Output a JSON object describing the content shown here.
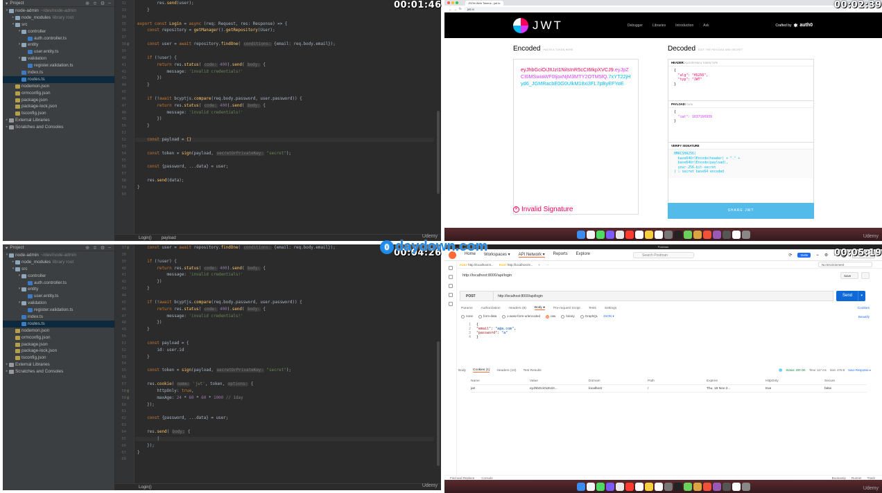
{
  "timestamps": {
    "tl": "00:01:46",
    "tr": "00:02:39",
    "bl": "00:04:26",
    "br": "00:05:19"
  },
  "udemy": "Udemy",
  "ide_top": {
    "project_label": "Project",
    "tree": [
      {
        "label": "node-admin",
        "hint": "~/dev/node-admin",
        "lvl": 0,
        "arrow": "▾",
        "icon": "fo"
      },
      {
        "label": "node_modules",
        "hint": "library root",
        "lvl": 1,
        "arrow": "▸",
        "icon": "fo"
      },
      {
        "label": "src",
        "hint": "",
        "lvl": 1,
        "arrow": "▾",
        "icon": "fo"
      },
      {
        "label": "controller",
        "hint": "",
        "lvl": 2,
        "arrow": "▾",
        "icon": "fo"
      },
      {
        "label": "auth.controller.ts",
        "hint": "",
        "lvl": 3,
        "arrow": "",
        "icon": "fts"
      },
      {
        "label": "entity",
        "hint": "",
        "lvl": 2,
        "arrow": "▾",
        "icon": "fo"
      },
      {
        "label": "user.entity.ts",
        "hint": "",
        "lvl": 3,
        "arrow": "",
        "icon": "fts"
      },
      {
        "label": "validation",
        "hint": "",
        "lvl": 2,
        "arrow": "▾",
        "icon": "fo"
      },
      {
        "label": "register.validation.ts",
        "hint": "",
        "lvl": 3,
        "arrow": "",
        "icon": "fts"
      },
      {
        "label": "index.ts",
        "hint": "",
        "lvl": 2,
        "arrow": "",
        "icon": "fts"
      },
      {
        "label": "routes.ts",
        "hint": "",
        "lvl": 2,
        "arrow": "",
        "icon": "fts",
        "sel": true
      },
      {
        "label": "nodemon.json",
        "hint": "",
        "lvl": 1,
        "arrow": "",
        "icon": "fjs"
      },
      {
        "label": "ormconfig.json",
        "hint": "",
        "lvl": 1,
        "arrow": "",
        "icon": "fjs"
      },
      {
        "label": "package.json",
        "hint": "",
        "lvl": 1,
        "arrow": "",
        "icon": "fjs"
      },
      {
        "label": "package-lock.json",
        "hint": "",
        "lvl": 1,
        "arrow": "",
        "icon": "fjs"
      },
      {
        "label": "tsconfig.json",
        "hint": "",
        "lvl": 1,
        "arrow": "",
        "icon": "fjs"
      },
      {
        "label": "External Libraries",
        "hint": "",
        "lvl": 0,
        "arrow": "▸",
        "icon": "fx"
      },
      {
        "label": "Scratches and Consoles",
        "hint": "",
        "lvl": 0,
        "arrow": "▸",
        "icon": "fx"
      }
    ],
    "code": [
      {
        "n": "32",
        "h": "        res.<span class='f'>send</span>(user);"
      },
      {
        "n": "33",
        "h": "    }"
      },
      {
        "n": "34",
        "h": ""
      },
      {
        "n": "35",
        "h": "<span class='k'>export const</span> <span class='f'>Login</span> = <span class='k'>async</span> (req: Request, res: Response) => {"
      },
      {
        "n": "36",
        "h": "    <span class='k'>const</span> repository = <span class='f'>getManager</span>().<span class='f'>getRepository</span>(User);"
      },
      {
        "n": "37",
        "h": ""
      },
      {
        "n": "38",
        "h": "    <span class='k'>const</span> user = <span class='k'>await</span> repository.<span class='f'>findOne</span>( <span class='h'>conditions:</span> {email: req.body.email});",
        "m": "@"
      },
      {
        "n": "39",
        "h": ""
      },
      {
        "n": "40",
        "h": "    <span class='k'>if</span> (!user) {"
      },
      {
        "n": "41",
        "h": "        <span class='k'>return</span> res.<span class='f'>status</span>( <span class='h'>code:</span> <span class='p'>400</span>).<span class='f'>send</span>( <span class='h'>body:</span> {"
      },
      {
        "n": "42",
        "h": "            message: <span class='s'>'invalid credentials!'</span>"
      },
      {
        "n": "43",
        "h": "        })"
      },
      {
        "n": "44",
        "h": "    }"
      },
      {
        "n": "45",
        "h": ""
      },
      {
        "n": "46",
        "h": "    <span class='k'>if</span> (!<span class='k'>await</span> bcyptjs.<span class='f'>compare</span>(req.body.password, user.password)) {"
      },
      {
        "n": "47",
        "h": "        <span class='k'>return</span> res.<span class='f'>status</span>( <span class='h'>code:</span> <span class='p'>400</span>).<span class='f'>send</span>( <span class='h'>body:</span> {"
      },
      {
        "n": "48",
        "h": "            message: <span class='s'>'invalid credentials!'</span>"
      },
      {
        "n": "49",
        "h": "        })"
      },
      {
        "n": "50",
        "h": "    }"
      },
      {
        "n": "51",
        "h": ""
      },
      {
        "n": "52",
        "h": "    <span class='k'>const</span> payload = <span class='f'>{}</span>",
        "hl": true
      },
      {
        "n": "53",
        "h": ""
      },
      {
        "n": "54",
        "h": "    <span class='k'>const</span> token = <span class='f'>sign</span>(payload, <span class='h'>secretOrPrivateKey:</span> <span class='s'>\"secret\"</span>);"
      },
      {
        "n": "55",
        "h": ""
      },
      {
        "n": "56",
        "h": "    <span class='k'>const</span> {password, ...data} = user;"
      },
      {
        "n": "57",
        "h": ""
      },
      {
        "n": "58",
        "h": "    res.<span class='f'>send</span>(data);"
      },
      {
        "n": "59",
        "h": "}"
      },
      {
        "n": "60",
        "h": ""
      }
    ],
    "breadcrumb": [
      "Login()",
      "payload"
    ]
  },
  "ide_bottom": {
    "project_label": "Project",
    "code": [
      {
        "n": "37",
        "h": "    <span class='k'>const</span> user = <span class='k'>await</span> repository.<span class='f'>findOne</span>( <span class='h'>conditions:</span> {email: req.body.email});",
        "m": "@"
      },
      {
        "n": "38",
        "h": ""
      },
      {
        "n": "39",
        "h": "    <span class='k'>if</span> (!user) {"
      },
      {
        "n": "40",
        "h": "        <span class='k'>return</span> res.<span class='f'>status</span>( <span class='h'>code:</span> <span class='p'>400</span>).<span class='f'>send</span>( <span class='h'>body:</span> {"
      },
      {
        "n": "41",
        "h": "            message: <span class='s'>'invalid credentials!'</span>"
      },
      {
        "n": "42",
        "h": "        })"
      },
      {
        "n": "43",
        "h": "    }"
      },
      {
        "n": "44",
        "h": ""
      },
      {
        "n": "45",
        "h": "    <span class='k'>if</span> (!<span class='k'>await</span> bcyptjs.<span class='f'>compare</span>(req.body.password, user.password)) {"
      },
      {
        "n": "46",
        "h": "        <span class='k'>return</span> res.<span class='f'>status</span>( <span class='h'>code:</span> <span class='p'>400</span>).<span class='f'>send</span>( <span class='h'>body:</span> {"
      },
      {
        "n": "47",
        "h": "            message: <span class='s'>'invalid credentials!'</span>"
      },
      {
        "n": "48",
        "h": "        })"
      },
      {
        "n": "49",
        "h": "    }"
      },
      {
        "n": "50",
        "h": ""
      },
      {
        "n": "51",
        "h": "    <span class='k'>const</span> payload = {"
      },
      {
        "n": "52",
        "h": "        id: user.id"
      },
      {
        "n": "53",
        "h": "    }"
      },
      {
        "n": "54",
        "h": ""
      },
      {
        "n": "55",
        "h": "    <span class='k'>const</span> token = <span class='f'>sign</span>(payload, <span class='h'>secretOrPrivateKey:</span> <span class='s'>\"secret\"</span>);"
      },
      {
        "n": "56",
        "h": ""
      },
      {
        "n": "57",
        "h": "    res.<span class='f'>cookie</span>( <span class='h'>name:</span> <span class='s'>'jwt'</span>, token, <span class='h'>options:</span> {"
      },
      {
        "n": "58",
        "h": "        httpOnly: <span class='k'>true</span>,",
        "m": "@"
      },
      {
        "n": "59",
        "h": "        maxAge: <span class='p'>24</span> * <span class='p'>60</span> * <span class='p'>60</span> * <span class='p'>1000</span> <span style='color:#808080'>// 1day</span>",
        "m": "@"
      },
      {
        "n": "60",
        "h": "    });"
      },
      {
        "n": "61",
        "h": ""
      },
      {
        "n": "62",
        "h": "    <span class='k'>const</span> {password, ...data} = user;"
      },
      {
        "n": "63",
        "h": ""
      },
      {
        "n": "64",
        "h": "    res.<span class='f'>send</span>( <span class='h'>body:</span> {"
      },
      {
        "n": "65",
        "h": "        |",
        "hl": true
      },
      {
        "n": "66",
        "h": "    });"
      },
      {
        "n": "67",
        "h": "}"
      },
      {
        "n": "68",
        "h": ""
      }
    ],
    "breadcrumb": [
      "Login()"
    ]
  },
  "browser": {
    "tab": "JSON Web Tokens - jwt.io",
    "url": "jwt.io",
    "logo": "JWT",
    "nav": [
      "Debugger",
      "Libraries",
      "Introduction",
      "Ask"
    ],
    "crafted": "Crafted by",
    "auth0": "auth0",
    "encoded": "Encoded",
    "encoded_sub": "PASTE A TOKEN HERE",
    "decoded": "Decoded",
    "decoded_sub": "EDIT THE PAYLOAD AND SECRET",
    "tok1": "eyJhbGciOiJIUzI1NiIsInR5cCI6IkpXVCJ9.",
    "tok2": "eyJpZCI6MSwiaWF0IjoxNjM3MTY2OTM5fQ.",
    "tok3": "7xYT22jHyd6_JGMRacbE0G0UlkM18xi3FL7pByEFYoE",
    "header_label": "HEADER:",
    "header_sub": "ALGORITHM & TOKEN TYPE",
    "payload_label": "PAYLOAD:",
    "payload_sub": "DATA",
    "verify_label": "VERIFY SIGNATURE",
    "invalid": "Invalid Signature",
    "share": "SHARE JWT"
  },
  "postman": {
    "app": "Postman",
    "nav": [
      "Home",
      "Workspaces ▾",
      "API Network ▾",
      "Reports",
      "Explore"
    ],
    "search": "Search Postman",
    "invite": "Invite",
    "upgrade": "Upgrade ▾",
    "tab1": "http://localhost:8...",
    "tab2": "http://localhost:8...",
    "env": "No Environment",
    "title": "http://localhost:8000/api/login",
    "save": "Save",
    "method": "POST",
    "req_url": "http://localhost:8000/api/login",
    "send": "Send",
    "subtabs": [
      "Params",
      "Authorization",
      "Headers (8)",
      "Body ●",
      "Pre-request Script",
      "Tests",
      "Settings"
    ],
    "cookies": "Cookies",
    "bodyopts": [
      "none",
      "form-data",
      "x-www-form-urlencoded",
      "raw",
      "binary",
      "GraphQL"
    ],
    "json": "JSON ▾",
    "beautify": "Beautify",
    "respt": [
      "Body",
      "Cookies (1)",
      "Headers (10)",
      "Test Results"
    ],
    "status": "Status: 200 OK",
    "time": "Time: 117 ms",
    "size": "Size: 475 B",
    "save_resp": "Save Response ▾",
    "ck_headers": [
      "Name",
      "Value",
      "Domain",
      "Path",
      "Expires",
      "HttpOnly",
      "Secure"
    ],
    "ck_row": [
      "jwt",
      "eyJhbGciOiJIUzI...",
      "localhost",
      "/",
      "Thu, 18 Nov 2...",
      "true",
      "false"
    ],
    "foot_left": [
      "Find and Replace",
      "Console"
    ],
    "foot_right": [
      "Bootcamp",
      "Runner",
      "Trash"
    ]
  },
  "watermark": "daydown.com"
}
